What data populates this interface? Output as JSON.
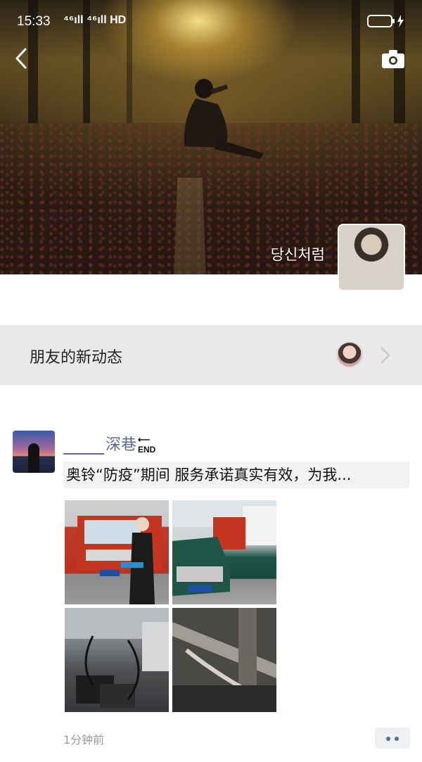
{
  "status_bar": {
    "time": "15:33",
    "network": "⁴⁶ıll ⁴⁶ıll HD",
    "battery_icon": "battery-charging-icon"
  },
  "header": {
    "back_icon": "chevron-left-icon",
    "camera_icon": "camera-icon"
  },
  "profile": {
    "name": "당신처럼"
  },
  "updates": {
    "label": "朋友的新动态",
    "chevron_icon": "chevron-right-icon"
  },
  "post": {
    "author": "深巷",
    "author_badge": "END",
    "text": "奥铃“防疫”期间 服务承诺真实有效，为我...",
    "images": [
      "truck-inspection-photo",
      "truck-fleet-photo",
      "battery-charging-photo",
      "undercarriage-photo"
    ],
    "time": "1分钟前",
    "more_icon": "more-dots-icon"
  },
  "colors": {
    "link_blue": "#5b6b94",
    "updates_bg": "#e9e9e9"
  }
}
